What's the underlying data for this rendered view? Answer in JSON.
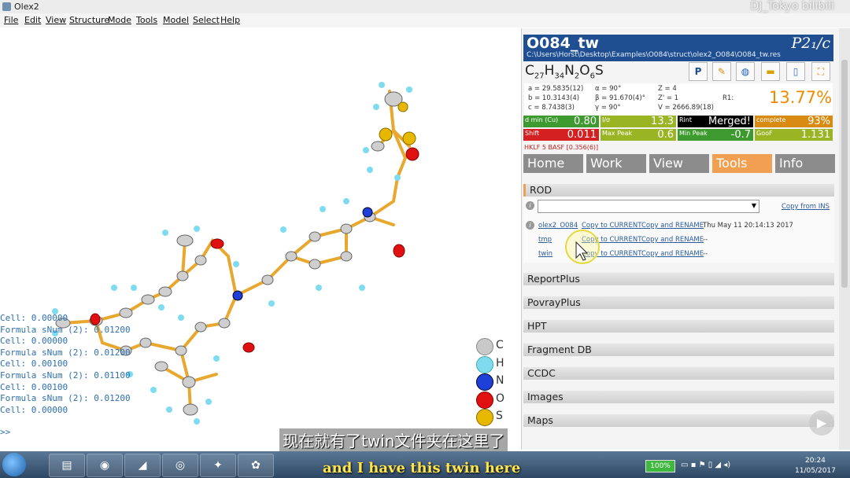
{
  "window": {
    "title": "Olex2",
    "watermark": "DJ_Tokyo bilibili"
  },
  "menu": [
    "File",
    "Edit",
    "View",
    "Structure",
    "Mode",
    "Tools",
    "Model",
    "Select",
    "Help"
  ],
  "console": {
    "lines": [
      "Cell: 0.00000",
      "Formula sNum (2): 0.01200",
      "Cell: 0.00000",
      "Formula sNum (2): 0.01200",
      "Cell: 0.00100",
      "Formula sNum (2): 0.01100",
      "Cell: 0.00100",
      "Formula sNum (2): 0.01200",
      "Cell: 0.00000"
    ],
    "prompt": ">>"
  },
  "legend": [
    {
      "symbol": "C",
      "color": "#c9c9c9"
    },
    {
      "symbol": "H",
      "color": "#7fdcf0"
    },
    {
      "symbol": "N",
      "color": "#1e3fd8"
    },
    {
      "symbol": "O",
      "color": "#e01010"
    },
    {
      "symbol": "S",
      "color": "#e6b800"
    }
  ],
  "structure": {
    "name": "O084_tw",
    "path": "C:\\Users\\Horst\\Desktop\\Examples\\O084\\struct\\olex2_O084\\O084_tw.res",
    "space_group": "P2₁/c",
    "formula_parts": [
      [
        "C",
        "27"
      ],
      [
        "H",
        "34"
      ],
      [
        "N",
        "2"
      ],
      [
        "O",
        "6"
      ],
      [
        "S",
        ""
      ]
    ],
    "cell": {
      "a": "a = 29.5835(12)",
      "b": "b = 10.3143(4)",
      "c": "c = 8.7438(3)",
      "alpha": "α = 90°",
      "beta": "β = 91.670(4)°",
      "gamma": "γ = 90°",
      "Z": "Z = 4",
      "Zp": "Z' = 1",
      "V": "V = 2666.89(18)"
    },
    "r1_label": "R1:",
    "r1_value": "13.77%",
    "hklf": "HKLF 5 BASF [0.356(6)]"
  },
  "toolbar_icons": [
    "refine-icon",
    "pencil-icon",
    "globe-icon",
    "folder-icon",
    "phone-icon",
    "fit-icon"
  ],
  "stats": [
    {
      "label": "d min (Cu)",
      "value": "0.80",
      "color": "#3d9a2e"
    },
    {
      "label": "I/σ",
      "value": "13.3",
      "color": "#9ab524"
    },
    {
      "label": "Rint",
      "value": "Merged!",
      "color": "#000000"
    },
    {
      "label": "complete",
      "value": "93%",
      "color": "#d88a12"
    },
    {
      "label": "Shift",
      "value": "0.011",
      "color": "#d42020"
    },
    {
      "label": "Max Peak",
      "value": "0.6",
      "color": "#9ab524"
    },
    {
      "label": "Min Peak",
      "value": "-0.7",
      "color": "#3d9a2e"
    },
    {
      "label": "GooF",
      "value": "1.131",
      "color": "#9ab524"
    }
  ],
  "tabs": [
    {
      "label": "Home",
      "active": false
    },
    {
      "label": "Work",
      "active": false
    },
    {
      "label": "View",
      "active": false
    },
    {
      "label": "Tools",
      "active": true
    },
    {
      "label": "Info",
      "active": false
    }
  ],
  "rod": {
    "title": "ROD",
    "copy_from": "Copy from INS",
    "rows": [
      {
        "name": "olex2_O084",
        "copy": "Copy to CURRENT",
        "rename": "Copy and RENAME",
        "date": "Thu May 11 20:14:13 2017"
      },
      {
        "name": "tmp",
        "copy": "Copy to CURRENT",
        "rename": "Copy and RENAME",
        "date": "--"
      },
      {
        "name": "twin",
        "copy": "Copy to CURRENT",
        "rename": "Copy and RENAME",
        "date": "--"
      }
    ]
  },
  "sections": [
    "ReportPlus",
    "PovrayPlus",
    "HPT",
    "Fragment DB",
    "CCDC",
    "Images",
    "Maps"
  ],
  "subtitles": {
    "cn": "现在就有了twin文件夹在这里了",
    "en": "and I have this twin here"
  },
  "taskbar": {
    "battery": "100%",
    "time": "20:24",
    "date": "11/05/2017"
  }
}
